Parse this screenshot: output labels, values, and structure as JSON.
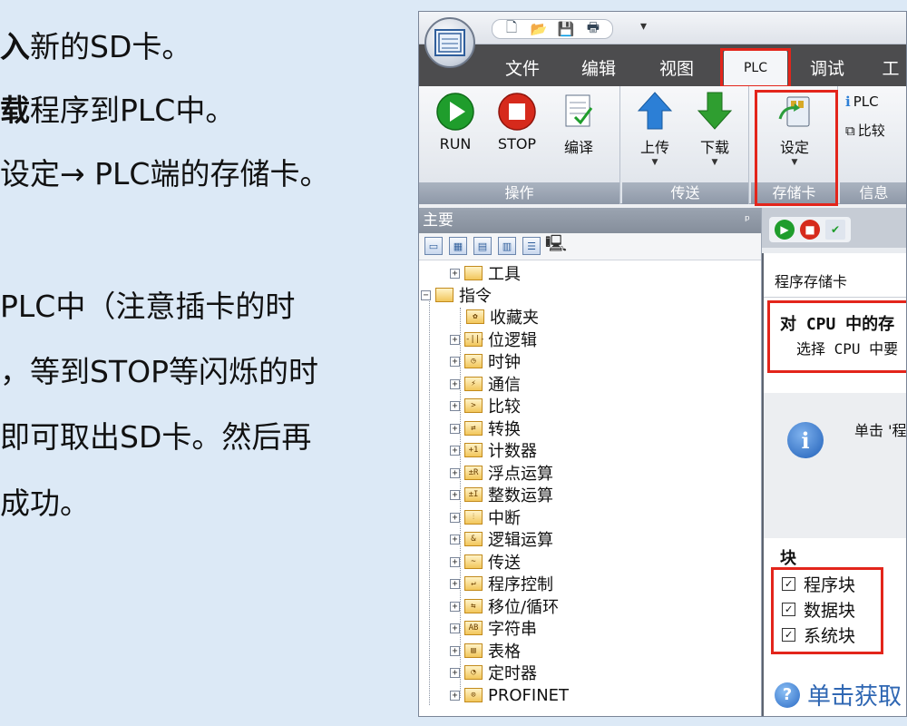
{
  "instructions": {
    "line1_bold": "入",
    "line1": "新的SD卡。",
    "line2_bold": "载",
    "line2": "程序到PLC中。",
    "line3": "设定→ PLC端的存储卡。",
    "line4": "PLC中（注意插卡的时",
    "line5": "，等到STOP等闪烁的时",
    "line6": "即可取出SD卡。然后再",
    "line7": "成功。"
  },
  "quick_access": {
    "app_button": "app-menu",
    "icons": [
      "new-file-icon",
      "open-folder-icon",
      "save-icon",
      "print-icon"
    ],
    "more": "▾"
  },
  "tabs": [
    {
      "label": "文件"
    },
    {
      "label": "编辑"
    },
    {
      "label": "视图"
    },
    {
      "label": "PLC"
    },
    {
      "label": "调试"
    },
    {
      "label": "工"
    }
  ],
  "ribbon": {
    "groups": {
      "operate": {
        "label": "操作",
        "run": "RUN",
        "stop": "STOP",
        "compile": "编译"
      },
      "transfer": {
        "label": "传送",
        "upload": "上传",
        "download": "下载"
      },
      "memory_card": {
        "label": "存储卡",
        "settings": "设定"
      },
      "info": {
        "label": "信息",
        "plc": "PLC",
        "compare": "比较"
      }
    },
    "colors": {
      "run": "#1f9d2c",
      "stop": "#d62a1c",
      "arrow_up": "#2c7fd6",
      "arrow_down": "#2f9e30"
    }
  },
  "tree_pane": {
    "title": "主要",
    "pin": "ᵖ",
    "items": [
      {
        "label": "工具",
        "icon": "folder",
        "level": 1
      },
      {
        "label": "指令",
        "icon": "folder",
        "level": 0
      },
      {
        "label": "收藏夹",
        "icon": "star",
        "level": 1
      },
      {
        "label": "位逻辑",
        "icon": "-||-",
        "level": 1
      },
      {
        "label": "时钟",
        "icon": "clock",
        "level": 1
      },
      {
        "label": "通信",
        "icon": "comm",
        "level": 1
      },
      {
        "label": "比较",
        "icon": ">",
        "level": 1
      },
      {
        "label": "转换",
        "icon": "conv",
        "level": 1
      },
      {
        "label": "计数器",
        "icon": "+1",
        "level": 1
      },
      {
        "label": "浮点运算",
        "icon": "±R",
        "level": 1
      },
      {
        "label": "整数运算",
        "icon": "±I",
        "level": 1
      },
      {
        "label": "中断",
        "icon": "int",
        "level": 1
      },
      {
        "label": "逻辑运算",
        "icon": "log",
        "level": 1
      },
      {
        "label": "传送",
        "icon": "mov",
        "level": 1
      },
      {
        "label": "程序控制",
        "icon": "jmp",
        "level": 1
      },
      {
        "label": "移位/循环",
        "icon": "shf",
        "level": 1
      },
      {
        "label": "字符串",
        "icon": "AB",
        "level": 1
      },
      {
        "label": "表格",
        "icon": "tbl",
        "level": 1
      },
      {
        "label": "定时器",
        "icon": "tmr",
        "level": 1
      },
      {
        "label": "PROFINET",
        "icon": "pn",
        "level": 1
      }
    ]
  },
  "dialog": {
    "title": "程序存储卡",
    "heading": "对 CPU 中的存",
    "subheading": "选择 CPU 中要",
    "info_text": "单击 '程",
    "block_label": "块",
    "checkboxes": [
      {
        "label": "程序块",
        "checked": true
      },
      {
        "label": "数据块",
        "checked": true
      },
      {
        "label": "系统块",
        "checked": true
      }
    ],
    "help_text": "单击获取"
  }
}
